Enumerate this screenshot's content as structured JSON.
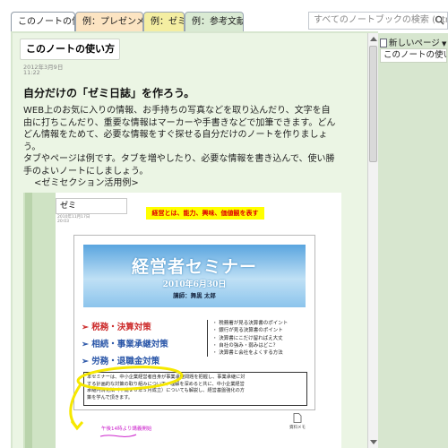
{
  "tabs": [
    {
      "label": "このノートの使い方",
      "color": "#ffffff",
      "active": true
    },
    {
      "label": "例：プレゼンメモ",
      "color": "#fce4c2",
      "active": false
    },
    {
      "label": "例：ゼミ",
      "color": "#f4eea2",
      "active": false
    },
    {
      "label": "例：参考文献",
      "color": "#d9ead3",
      "active": false
    }
  ],
  "search": {
    "placeholder": "すべてのノートブックの検索 (Ctrl+E)"
  },
  "sidebar": {
    "new_page_label": "新しいページ",
    "pages": [
      {
        "label": "このノートの使い方",
        "selected": true
      }
    ]
  },
  "page": {
    "title": "このノートの使い方",
    "date": "2012年3月9日",
    "time": "11:22",
    "heading": "自分だけの「ゼミ日誌」を作ろう。",
    "paragraph_lines": [
      "WEB上のお気に入りの情報、お手持ちの写真などを取り込んだり、文字を自",
      "由に打ちこんだり、重要な情報はマーカーや手書きなどで加筆できます。どん",
      "どん情報をためて、必要な情報をすぐ探せる自分だけのノートを作りましょ",
      "う。",
      "タブやページは例です。タブを増やしたり、必要な情報を書き込んで、使い勝",
      "手のよいノートにしましょう。"
    ],
    "example_heading": "<ゼミセクション活用例>"
  },
  "inner_page": {
    "title": "ゼミ",
    "date": "2010年11月17日",
    "time": "20:03",
    "highlight_text": "経営とは、能力、興味、価値観を表す",
    "handwritten_note": "午後14時より講義開始"
  },
  "slide": {
    "title": "経営者セミナー",
    "date": "2010年6月30日",
    "speaker": "講師：舞黒 太郎",
    "items": [
      {
        "text": "➢ 税務・決算対策",
        "color": "red"
      },
      {
        "text": "➢ 相続・事業承継対策",
        "color": "blue"
      },
      {
        "text": "➢ 労務・退職金対策",
        "color": "blue"
      }
    ],
    "bullets": [
      "・ 税務署が見る決算書のポイント",
      "・ 銀行が見る決算書のポイント",
      "・ 決算書にこだけ留ればえ大丈",
      "・ 自社の強み・弱みはどこ？",
      "・ 決算書と会社をよくする方法"
    ],
    "description_lines": [
      "本セミナーは、中小企業経営者自身が事業承継問題を把握し、事業承継に対",
      "する計画的な対策の取り組みについて、理解を深めると共に、中小企業経営",
      "承継円滑化法（平成２０年５月成立）についても解説し、経営基盤強化の方",
      "策を学んで頂きます。"
    ],
    "footer_icon_label": "資料メモ"
  },
  "colors": {
    "page_bg": "#ebf5e4",
    "frame_bg": "#d7e6cf",
    "highlight": "#ffff00",
    "highlight_text": "#e00000",
    "annotation": "#cc22cc",
    "red_item": "#cc2a2a",
    "blue_item": "#2a56a8"
  }
}
